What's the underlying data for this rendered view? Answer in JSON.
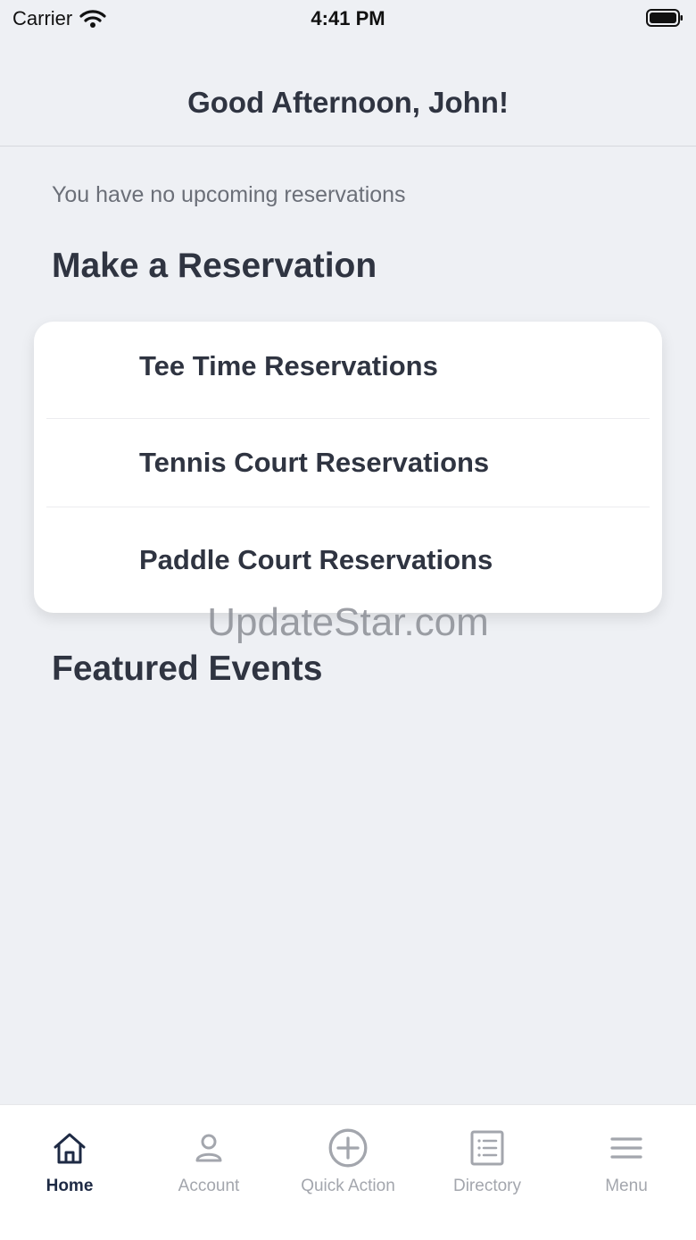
{
  "status_bar": {
    "carrier": "Carrier",
    "time": "4:41 PM"
  },
  "header": {
    "greeting": "Good Afternoon, John!"
  },
  "reservations": {
    "empty_text": "You have no upcoming reservations",
    "section_title": "Make a Reservation",
    "items": [
      {
        "label": "Tee Time Reservations"
      },
      {
        "label": "Tennis Court Reservations"
      },
      {
        "label": "Paddle Court Reservations"
      }
    ]
  },
  "watermark": "UpdateStar.com",
  "events": {
    "section_title": "Featured Events"
  },
  "tabbar": {
    "items": [
      {
        "label": "Home",
        "icon": "home-icon"
      },
      {
        "label": "Account",
        "icon": "person-icon"
      },
      {
        "label": "Quick Action",
        "icon": "plus-circle-icon"
      },
      {
        "label": "Directory",
        "icon": "list-icon"
      },
      {
        "label": "Menu",
        "icon": "hamburger-icon"
      }
    ],
    "active_index": 0,
    "active_color": "#1e2a44",
    "inactive_color": "#a3a6ad"
  }
}
